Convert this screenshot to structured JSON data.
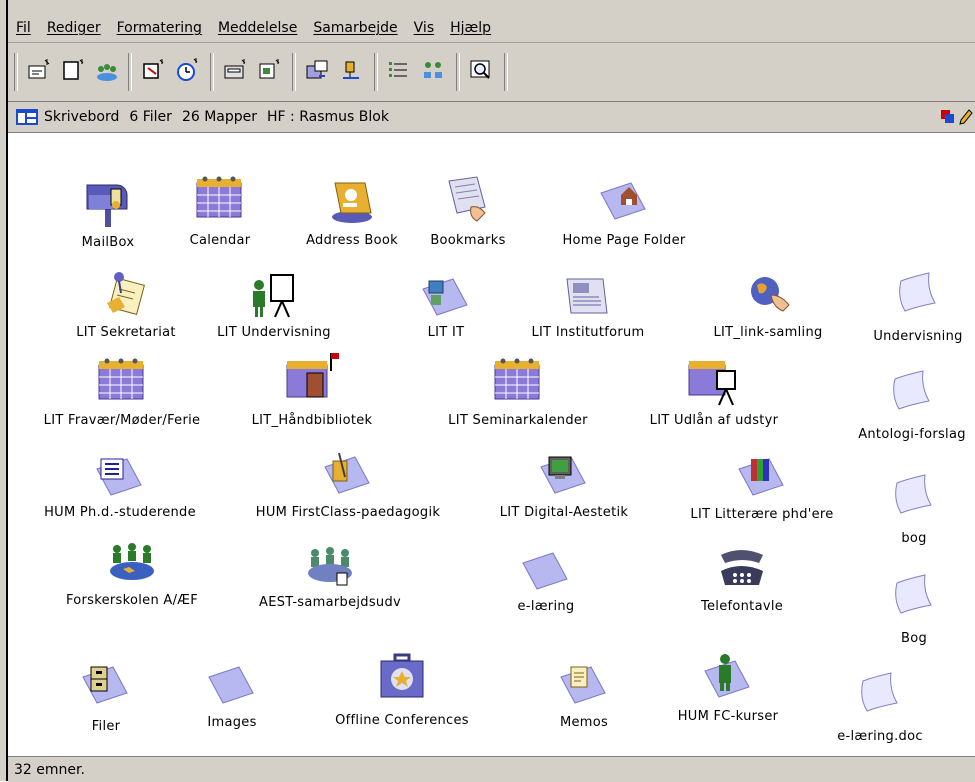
{
  "menu": [
    "Fil",
    "Rediger",
    "Formatering",
    "Meddelelse",
    "Samarbejde",
    "Vis",
    "Hjælp"
  ],
  "path": {
    "location": "Skrivebord",
    "files": "6 Filer",
    "folders": "26 Mapper",
    "user": "HF : Rasmus Blok"
  },
  "status": "32 emner.",
  "colors": {
    "chrome": "#d4d0c8",
    "folder": "#b8b8f0",
    "folder_dark": "#7878c8",
    "calendar": "#8c7ad8",
    "calendar_top": "#e8b030"
  },
  "icons": [
    {
      "label": "MailBox",
      "kind": "mailbox-icon"
    },
    {
      "label": "Calendar",
      "kind": "calendar-icon"
    },
    {
      "label": "Address Book",
      "kind": "address-book-icon"
    },
    {
      "label": "Bookmarks",
      "kind": "bookmarks-icon"
    },
    {
      "label": "Home Page Folder",
      "kind": "home-folder-icon"
    },
    {
      "label": "LIT Sekretariat",
      "kind": "conference-icon"
    },
    {
      "label": "LIT Undervisning",
      "kind": "presenter-icon"
    },
    {
      "label": "LIT IT",
      "kind": "folder-icon"
    },
    {
      "label": "LIT Institutforum",
      "kind": "newspaper-icon"
    },
    {
      "label": "LIT_link-samling",
      "kind": "globe-hand-icon"
    },
    {
      "label": "Undervisning",
      "kind": "document-icon"
    },
    {
      "label": "LIT Fravær/Møder/Ferie",
      "kind": "calendar-icon"
    },
    {
      "label": "LIT_Håndbibliotek",
      "kind": "calendar-door-icon"
    },
    {
      "label": "LIT Seminarkalender",
      "kind": "calendar-icon"
    },
    {
      "label": "LIT Udlån af udstyr",
      "kind": "calendar-easel-icon"
    },
    {
      "label": "Antologi-forslag",
      "kind": "document-icon"
    },
    {
      "label": "HUM Ph.d.-studerende",
      "kind": "folder-list-icon"
    },
    {
      "label": "HUM FirstClass-paedagogik",
      "kind": "folder-tools-icon"
    },
    {
      "label": "LIT Digital-Aestetik",
      "kind": "folder-monitor-icon"
    },
    {
      "label": "LIT Litterære phd'ere",
      "kind": "folder-books-icon"
    },
    {
      "label": "bog",
      "kind": "document-icon"
    },
    {
      "label": "Forskerskolen A/ÆF",
      "kind": "group-icon"
    },
    {
      "label": "AEST-samarbejdsudv",
      "kind": "group-folder-icon"
    },
    {
      "label": "e-læring",
      "kind": "folder-icon"
    },
    {
      "label": "Telefontavle",
      "kind": "telephone-icon"
    },
    {
      "label": "Bog",
      "kind": "document-icon"
    },
    {
      "label": "Filer",
      "kind": "cabinet-folder-icon"
    },
    {
      "label": "Images",
      "kind": "folder-icon"
    },
    {
      "label": "Offline Conferences",
      "kind": "briefcase-icon"
    },
    {
      "label": "Memos",
      "kind": "memo-folder-icon"
    },
    {
      "label": "HUM FC-kurser",
      "kind": "person-folder-icon"
    },
    {
      "label": "e-læring.doc",
      "kind": "document-icon"
    }
  ]
}
